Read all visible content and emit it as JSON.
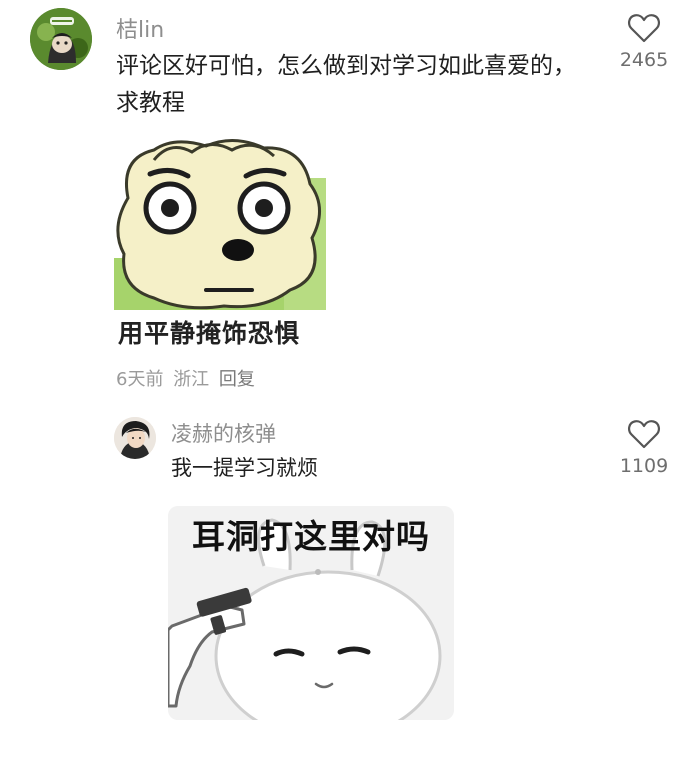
{
  "comments": [
    {
      "username": "桔lin",
      "avatar_icon": "green-cartoon-avatar",
      "text": "评论区好可怕，怎么做到对学习如此喜爱的，求教程",
      "sticker": {
        "icon": "surprised-sheep-sticker",
        "caption": "用平静掩饰恐惧"
      },
      "meta": {
        "time": "6天前",
        "location": "浙江",
        "reply_label": "回复"
      },
      "likes": "2465",
      "like_icon": "heart-outline-icon"
    },
    {
      "username": "凌赫的核弹",
      "avatar_icon": "person-avatar",
      "text": "我一提学习就烦",
      "sticker": {
        "icon": "rabbit-gun-sticker",
        "caption": "耳洞打这里对吗"
      },
      "likes": "1109",
      "like_icon": "heart-outline-icon"
    }
  ],
  "colors": {
    "username": "#8e8e8e",
    "text": "#1f1f1f",
    "meta": "#9a9a9a",
    "like_count": "#6e6e6e"
  }
}
